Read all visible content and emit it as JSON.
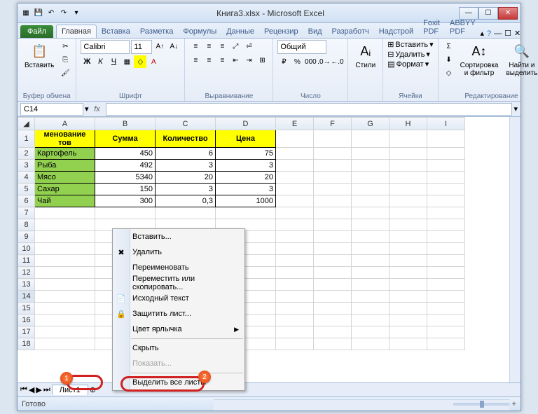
{
  "title": "Книга3.xlsx - Microsoft Excel",
  "qat": {
    "save": "💾",
    "undo": "↶",
    "redo": "↷"
  },
  "tabs": {
    "file": "Файл",
    "items": [
      "Главная",
      "Вставка",
      "Разметка",
      "Формулы",
      "Данные",
      "Рецензир",
      "Вид",
      "Разработч",
      "Надстрой",
      "Foxit PDF",
      "ABBYY PDF"
    ],
    "active": 0
  },
  "ribbon": {
    "clipboard": {
      "paste": "Вставить",
      "label": "Буфер обмена"
    },
    "font": {
      "name": "Calibri",
      "size": "11",
      "label": "Шрифт"
    },
    "align": {
      "label": "Выравнивание"
    },
    "number": {
      "format": "Общий",
      "label": "Число"
    },
    "styles": {
      "btn": "Стили",
      "label": ""
    },
    "cells": {
      "insert": "Вставить",
      "delete": "Удалить",
      "format": "Формат",
      "label": "Ячейки"
    },
    "edit": {
      "sort": "Сортировка\nи фильтр",
      "find": "Найти и\nвыделить",
      "label": "Редактирование"
    }
  },
  "namebox": "C14",
  "columns": [
    "A",
    "B",
    "C",
    "D",
    "E",
    "F",
    "G",
    "H",
    "I"
  ],
  "rows_hdr": [
    1,
    2,
    3,
    4,
    5,
    6,
    7,
    8,
    9,
    10,
    11,
    12,
    13,
    14,
    15,
    16,
    17,
    18
  ],
  "headers": [
    "менование тов",
    "Сумма",
    "Количество",
    "Цена"
  ],
  "data": [
    {
      "name": "Картофель",
      "sum": "450",
      "qty": "6",
      "price": "75"
    },
    {
      "name": "Рыба",
      "sum": "492",
      "qty": "3",
      "price": "3"
    },
    {
      "name": "Мясо",
      "sum": "5340",
      "qty": "20",
      "price": "20"
    },
    {
      "name": "Сахар",
      "sum": "150",
      "qty": "3",
      "price": "3"
    },
    {
      "name": "Чай",
      "sum": "300",
      "qty": "0,3",
      "price": "1000"
    }
  ],
  "sheet_tab": "Лист1",
  "status": "Готово",
  "zoom": "100%",
  "context_menu": [
    {
      "label": "Вставить...",
      "icon": ""
    },
    {
      "label": "Удалить",
      "icon": "✖"
    },
    {
      "label": "Переименовать",
      "icon": ""
    },
    {
      "label": "Переместить или скопировать...",
      "icon": ""
    },
    {
      "label": "Исходный текст",
      "icon": "📄"
    },
    {
      "label": "Защитить лист...",
      "icon": "🔒"
    },
    {
      "label": "Цвет ярлычка",
      "icon": "",
      "submenu": true
    },
    {
      "label": "Скрыть",
      "icon": ""
    },
    {
      "label": "Показать...",
      "icon": "",
      "disabled": true
    },
    {
      "label": "Выделить все листы",
      "icon": ""
    }
  ],
  "badges": {
    "one": "1",
    "two": "2"
  }
}
